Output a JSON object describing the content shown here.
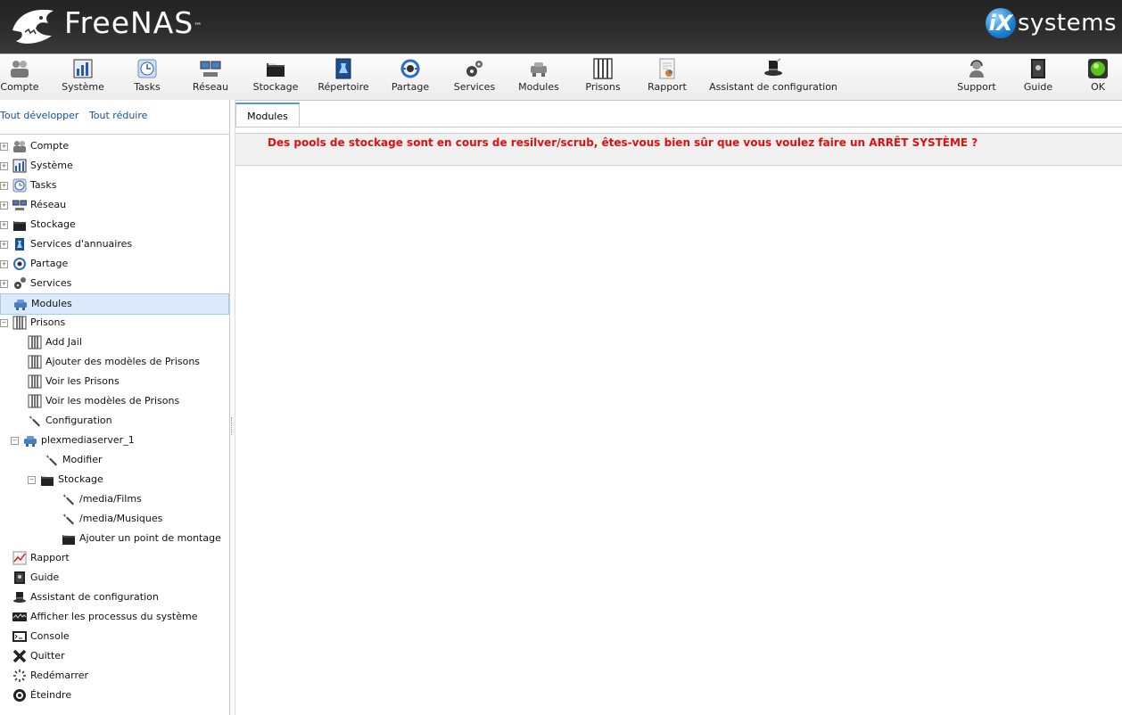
{
  "header": {
    "brand": "FreeNAS",
    "brand_mark": "™",
    "partner_prefix": "iX",
    "partner_suffix": "systems"
  },
  "toolbar": {
    "items": [
      {
        "label": "Compte",
        "icon": "users-icon"
      },
      {
        "label": "Système",
        "icon": "system-chart-icon"
      },
      {
        "label": "Tasks",
        "icon": "clock-icon"
      },
      {
        "label": "Réseau",
        "icon": "network-icon"
      },
      {
        "label": "Stockage",
        "icon": "folder-icon"
      },
      {
        "label": "Répertoire",
        "icon": "directory-icon"
      },
      {
        "label": "Partage",
        "icon": "share-icon"
      },
      {
        "label": "Services",
        "icon": "gears-icon"
      },
      {
        "label": "Modules",
        "icon": "plugin-icon"
      },
      {
        "label": "Prisons",
        "icon": "jail-icon"
      },
      {
        "label": "Rapport",
        "icon": "report-icon"
      },
      {
        "label": "Assistant de configuration",
        "icon": "wizard-hat-icon"
      }
    ],
    "right_items": [
      {
        "label": "Support",
        "icon": "support-icon"
      },
      {
        "label": "Guide",
        "icon": "guide-book-icon"
      },
      {
        "label": "OK",
        "icon": "status-ok-icon"
      }
    ]
  },
  "sidebar": {
    "expand_all": "Tout développer",
    "collapse_all": "Tout réduire",
    "tree": [
      {
        "label": "Compte",
        "toggle": "+",
        "icon": "users-icon"
      },
      {
        "label": "Système",
        "toggle": "+",
        "icon": "system-chart-icon"
      },
      {
        "label": "Tasks",
        "toggle": "+",
        "icon": "clock-icon"
      },
      {
        "label": "Réseau",
        "toggle": "+",
        "icon": "network-icon"
      },
      {
        "label": "Stockage",
        "toggle": "+",
        "icon": "folder-icon"
      },
      {
        "label": "Services d'annuaires",
        "toggle": "+",
        "icon": "directory-icon"
      },
      {
        "label": "Partage",
        "toggle": "+",
        "icon": "share-icon"
      },
      {
        "label": "Services",
        "toggle": "+",
        "icon": "gears-icon"
      },
      {
        "label": "Modules",
        "toggle": "",
        "icon": "plugin-icon",
        "selected": true
      },
      {
        "label": "Prisons",
        "toggle": "−",
        "icon": "jail-icon"
      },
      {
        "label": "Add Jail",
        "icon": "jail-icon"
      },
      {
        "label": "Ajouter des modèles de Prisons",
        "icon": "jail-icon"
      },
      {
        "label": "Voir les Prisons",
        "icon": "jail-icon"
      },
      {
        "label": "Voir les modèles de Prisons",
        "icon": "jail-icon"
      },
      {
        "label": "Configuration",
        "icon": "wrench-icon"
      },
      {
        "label": "plexmediaserver_1",
        "toggle": "−",
        "icon": "plugin-icon"
      },
      {
        "label": "Modifier",
        "icon": "wrench-icon"
      },
      {
        "label": "Stockage",
        "toggle": "−",
        "icon": "folder-icon"
      },
      {
        "label": "/media/Films",
        "icon": "wrench-icon"
      },
      {
        "label": "/media/Musiques",
        "icon": "wrench-icon"
      },
      {
        "label": "Ajouter un point de montage",
        "icon": "folder-icon"
      },
      {
        "label": "Rapport",
        "icon": "report-icon"
      },
      {
        "label": "Guide",
        "icon": "guide-book-icon"
      },
      {
        "label": "Assistant de configuration",
        "icon": "wizard-hat-icon"
      },
      {
        "label": "Afficher les processus du système",
        "icon": "process-monitor-icon"
      },
      {
        "label": "Console",
        "icon": "console-icon"
      },
      {
        "label": "Quitter",
        "icon": "logout-x-icon"
      },
      {
        "label": "Redémarrer",
        "icon": "restart-spinner-icon"
      },
      {
        "label": "Éteindre",
        "icon": "power-icon"
      }
    ]
  },
  "main": {
    "tab_label": "Modules",
    "warning": "Des pools de stockage sont en cours de resilver/scrub, êtes-vous bien sûr que vous voulez faire un ARRÊT SYSTÈME ?"
  },
  "colors": {
    "warning_text": "#e01010",
    "selection_bg": "#dbeafb",
    "link": "#1a4fa0"
  }
}
